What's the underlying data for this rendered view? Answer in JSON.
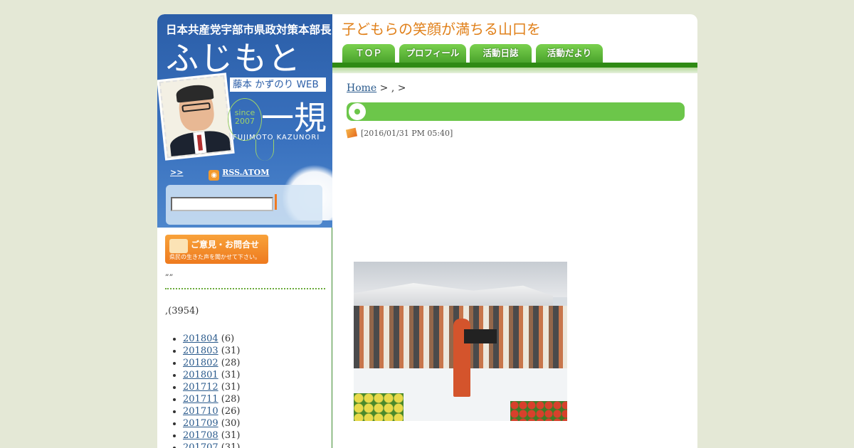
{
  "banner": {
    "org": "日本共産党宇部市県政対策本部長",
    "name_kana": "ふじもと",
    "web_tag": "藤本 かずのり WEB",
    "name_kanji": "一規",
    "since": "since\n2007",
    "romaji": "FUJIMOTO KAZUNORI",
    "link_more": ">>",
    "rss": "RSS.ATOM"
  },
  "sidebar": {
    "contact_title": "ご意見・お問合せ",
    "contact_sub": "県民の生きた声を聞かせて下さい。",
    "quote": "„„",
    "category_total": ",(3954)",
    "archives": [
      {
        "label": "201804",
        "count": "(6)"
      },
      {
        "label": "201803",
        "count": "(31)"
      },
      {
        "label": "201802",
        "count": "(28)"
      },
      {
        "label": "201801",
        "count": "(31)"
      },
      {
        "label": "201712",
        "count": "(31)"
      },
      {
        "label": "201711",
        "count": "(28)"
      },
      {
        "label": "201710",
        "count": "(26)"
      },
      {
        "label": "201709",
        "count": "(30)"
      },
      {
        "label": "201708",
        "count": "(31)"
      },
      {
        "label": "201707",
        "count": "(31)"
      }
    ]
  },
  "header": {
    "tagline": "子どもらの笑顔が満ちる山口を",
    "tabs": [
      "ＴＯＰ",
      "プロフィール",
      "活動日誌",
      "活動だより"
    ]
  },
  "entry": {
    "breadcrumb_home": "Home",
    "breadcrumb_rest": " > , >",
    "date": "[2016/01/31  PM 05:40]"
  }
}
